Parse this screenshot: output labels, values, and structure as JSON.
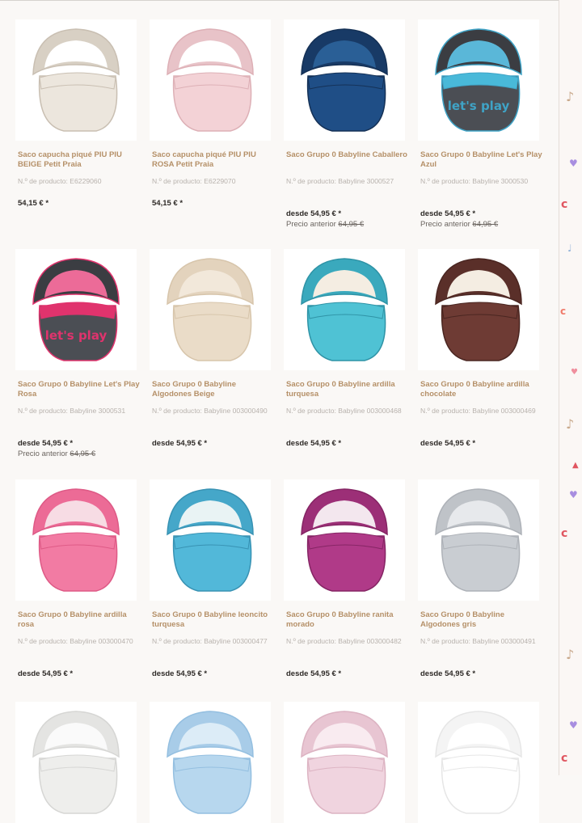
{
  "products": [
    {
      "title": "Saco capucha piqué PIU PIU BEIGE Petit Praia",
      "number": "N.º de producto: E6229060",
      "price": "54,15 € *",
      "prev_label": "",
      "prev_value": "",
      "img": {
        "body": "#ece6dd",
        "hood": "#d8d0c4",
        "accent": "#c9bfb2",
        "lining": "#ffffff",
        "stripe": "#ece6dd",
        "text": ""
      }
    },
    {
      "title": "Saco capucha piqué PIU PIU ROSA Petit Praia",
      "number": "N.º de producto: E6229070",
      "price": "54,15 € *",
      "prev_label": "",
      "prev_value": "",
      "img": {
        "body": "#f3d2d6",
        "hood": "#e8c3c8",
        "accent": "#ddb0b6",
        "lining": "#ffffff",
        "stripe": "#f3d2d6",
        "text": ""
      }
    },
    {
      "title": "Saco Grupo 0 Babyline Caballero",
      "number": "N.º de producto: Babyline 3000527",
      "price": "desde 54,95 € *",
      "prev_label": "Precio anterior",
      "prev_value": "64,95 €",
      "img": {
        "body": "#1f4e86",
        "hood": "#183a66",
        "accent": "#153156",
        "lining": "#2a5f96",
        "stripe": "#1f4e86",
        "text": ""
      }
    },
    {
      "title": "Saco Grupo 0 Babyline Let's Play Azul",
      "number": "N.º de producto: Babyline 3000530",
      "price": "desde 54,95 € *",
      "prev_label": "Precio anterior",
      "prev_value": "64,95 €",
      "img": {
        "body": "#4b4e54",
        "hood": "#3b3d42",
        "accent": "#3fa3c6",
        "lining": "#5ab7d8",
        "stripe": "#49b9d9",
        "text": "let's play"
      }
    },
    {
      "title": "Saco Grupo 0 Babyline Let's Play Rosa",
      "number": "N.º de producto: Babyline 3000531",
      "price": "desde 54,95 € *",
      "prev_label": "Precio anterior",
      "prev_value": "64,95 €",
      "img": {
        "body": "#4b4e54",
        "hood": "#3b3d42",
        "accent": "#e0336d",
        "lining": "#ec6b98",
        "stripe": "#e0336d",
        "text": "let's play"
      }
    },
    {
      "title": "Saco Grupo 0 Babyline Algodones Beige",
      "number": "N.º de producto: Babyline 003000490",
      "price": "desde 54,95 € *",
      "prev_label": "",
      "prev_value": "",
      "img": {
        "body": "#eadcc8",
        "hood": "#e3d3bd",
        "accent": "#d7c5ab",
        "lining": "#f2e8da",
        "stripe": "#eadcc8",
        "text": ""
      }
    },
    {
      "title": "Saco Grupo 0 Babyline ardilla turquesa",
      "number": "N.º de producto: Babyline 003000468",
      "price": "desde 54,95 € *",
      "prev_label": "",
      "prev_value": "",
      "img": {
        "body": "#4fc2d4",
        "hood": "#3aa9bd",
        "accent": "#2f93a6",
        "lining": "#f4ede2",
        "stripe": "#4fc2d4",
        "text": ""
      }
    },
    {
      "title": "Saco Grupo 0 Babyline ardilla chocolate",
      "number": "N.º de producto: Babyline 003000469",
      "price": "desde 54,95 € *",
      "prev_label": "",
      "prev_value": "",
      "img": {
        "body": "#6e3b34",
        "hood": "#5a2f29",
        "accent": "#4a2621",
        "lining": "#f4ede2",
        "stripe": "#6e3b34",
        "text": ""
      }
    },
    {
      "title": "Saco Grupo 0 Babyline ardilla rosa",
      "number": "N.º de producto: Babyline 003000470",
      "price": "desde 54,95 € *",
      "prev_label": "",
      "prev_value": "",
      "img": {
        "body": "#f27ba3",
        "hood": "#ec6b96",
        "accent": "#de5a86",
        "lining": "#f7dce4",
        "stripe": "#f27ba3",
        "text": ""
      }
    },
    {
      "title": "Saco Grupo 0 Babyline leoncito turquesa",
      "number": "N.º de producto: Babyline 003000477",
      "price": "desde 54,95 € *",
      "prev_label": "",
      "prev_value": "",
      "img": {
        "body": "#52b8d9",
        "hood": "#45a7c9",
        "accent": "#3892b3",
        "lining": "#e9f3f4",
        "stripe": "#52b8d9",
        "text": ""
      }
    },
    {
      "title": "Saco Grupo 0 Babyline ranita morado",
      "number": "N.º de producto: Babyline 003000482",
      "price": "desde 54,95 € *",
      "prev_label": "",
      "prev_value": "",
      "img": {
        "body": "#b03a88",
        "hood": "#9c2f77",
        "accent": "#852564",
        "lining": "#f3e7ee",
        "stripe": "#b03a88",
        "text": ""
      }
    },
    {
      "title": "Saco Grupo 0 Babyline Algodones gris",
      "number": "N.º de producto: Babyline 003000491",
      "price": "desde 54,95 € *",
      "prev_label": "",
      "prev_value": "",
      "img": {
        "body": "#c9cdd2",
        "hood": "#bfc3c8",
        "accent": "#aeb2b8",
        "lining": "#e7e9ec",
        "stripe": "#c9cdd2",
        "text": ""
      }
    },
    {
      "title": "",
      "number": "",
      "price": "",
      "prev_label": "",
      "prev_value": "",
      "img": {
        "body": "#eeeeec",
        "hood": "#e4e4e2",
        "accent": "#d6d6d4",
        "lining": "#fafafa",
        "stripe": "#eeeeec",
        "text": ""
      }
    },
    {
      "title": "",
      "number": "",
      "price": "",
      "prev_label": "",
      "prev_value": "",
      "img": {
        "body": "#b7d7ee",
        "hood": "#a8cce8",
        "accent": "#94bfe0",
        "lining": "#dcecf7",
        "stripe": "#b7d7ee",
        "text": ""
      }
    },
    {
      "title": "",
      "number": "",
      "price": "",
      "prev_label": "",
      "prev_value": "",
      "img": {
        "body": "#f0d4df",
        "hood": "#e8c5d2",
        "accent": "#dcb3c2",
        "lining": "#f9ebf0",
        "stripe": "#f0d4df",
        "text": ""
      }
    },
    {
      "title": "",
      "number": "",
      "price": "",
      "prev_label": "",
      "prev_value": "",
      "img": {
        "body": "#ffffff",
        "hood": "#f4f4f4",
        "accent": "#e6e6e6",
        "lining": "#ffffff",
        "stripe": "#ffffff",
        "text": ""
      }
    }
  ]
}
